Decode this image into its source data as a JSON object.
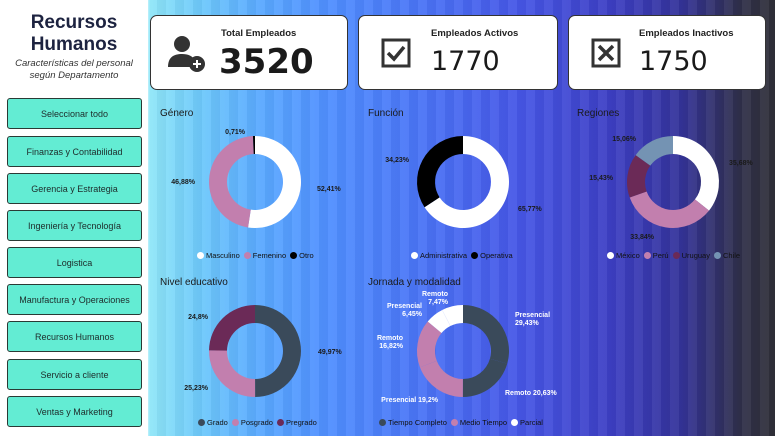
{
  "app": {
    "title": "Recursos Humanos",
    "subtitle": "Características del personal según Departamento"
  },
  "departments": [
    "Seleccionar todo",
    "Finanzas y Contabilidad",
    "Gerencia y Estrategia",
    "Ingeniería y Tecnología",
    "Logistica",
    "Manufactura y Operaciones",
    "Recursos Humanos",
    "Servicio a cliente",
    "Ventas y Marketing"
  ],
  "kpis": {
    "total": {
      "label": "Total Empleados",
      "value": "3520",
      "icon": "user-add-icon"
    },
    "active": {
      "label": "Empleados Activos",
      "value": "1770",
      "icon": "checkbox-checked-icon"
    },
    "inactive": {
      "label": "Empleados Inactivos",
      "value": "1750",
      "icon": "checkbox-x-icon"
    }
  },
  "colors": {
    "white": "#ffffff",
    "pink": "#c27fae",
    "black": "#000000",
    "plum": "#6b2a57",
    "slate": "#3a4a5a",
    "steel": "#7493b3",
    "teal": "#63ecd3"
  },
  "chart_data": [
    {
      "id": "genero",
      "type": "pie",
      "title": "Género",
      "labels": [
        "Masculino",
        "Femenino",
        "Otro"
      ],
      "values": [
        52.41,
        46.88,
        0.71
      ],
      "display": [
        "52,41%",
        "46,88%",
        "0,71%"
      ]
    },
    {
      "id": "funcion",
      "type": "pie",
      "title": "Función",
      "labels": [
        "Administrativa",
        "Operativa"
      ],
      "values": [
        65.77,
        34.23
      ],
      "display": [
        "65,77%",
        "34,23%"
      ]
    },
    {
      "id": "regiones",
      "type": "pie",
      "title": "Regiones",
      "labels": [
        "México",
        "Perú",
        "Uruguay",
        "Chile"
      ],
      "values": [
        35.68,
        33.84,
        15.43,
        15.06
      ],
      "display": [
        "35,68%",
        "33,84%",
        "15,43%",
        "15,06%"
      ]
    },
    {
      "id": "educacion",
      "type": "pie",
      "title": "Nivel educativo",
      "labels": [
        "Grado",
        "Posgrado",
        "Pregrado"
      ],
      "values": [
        49.97,
        25.23,
        24.8
      ],
      "display": [
        "49,97%",
        "25,23%",
        "24,8%"
      ]
    },
    {
      "id": "jornada",
      "type": "pie",
      "title": "Jornada y modalidad",
      "labels": [
        "Tiempo Completo",
        "Medio Tiempo",
        "Parcial"
      ],
      "slices": [
        {
          "label": "Presencial",
          "group": "Tiempo Completo",
          "value": 29.43,
          "display": "29,43%"
        },
        {
          "label": "Remoto",
          "group": "Tiempo Completo",
          "value": 20.63,
          "display": "20,63%"
        },
        {
          "label": "Presencial",
          "group": "Medio Tiempo",
          "value": 19.2,
          "display": "19,2%"
        },
        {
          "label": "Remoto",
          "group": "Medio Tiempo",
          "value": 16.82,
          "display": "16,82%"
        },
        {
          "label": "Presencial",
          "group": "Parcial",
          "value": 6.45,
          "display": "6,45%"
        },
        {
          "label": "Remoto",
          "group": "Parcial",
          "value": 7.47,
          "display": "7,47%"
        }
      ]
    }
  ]
}
